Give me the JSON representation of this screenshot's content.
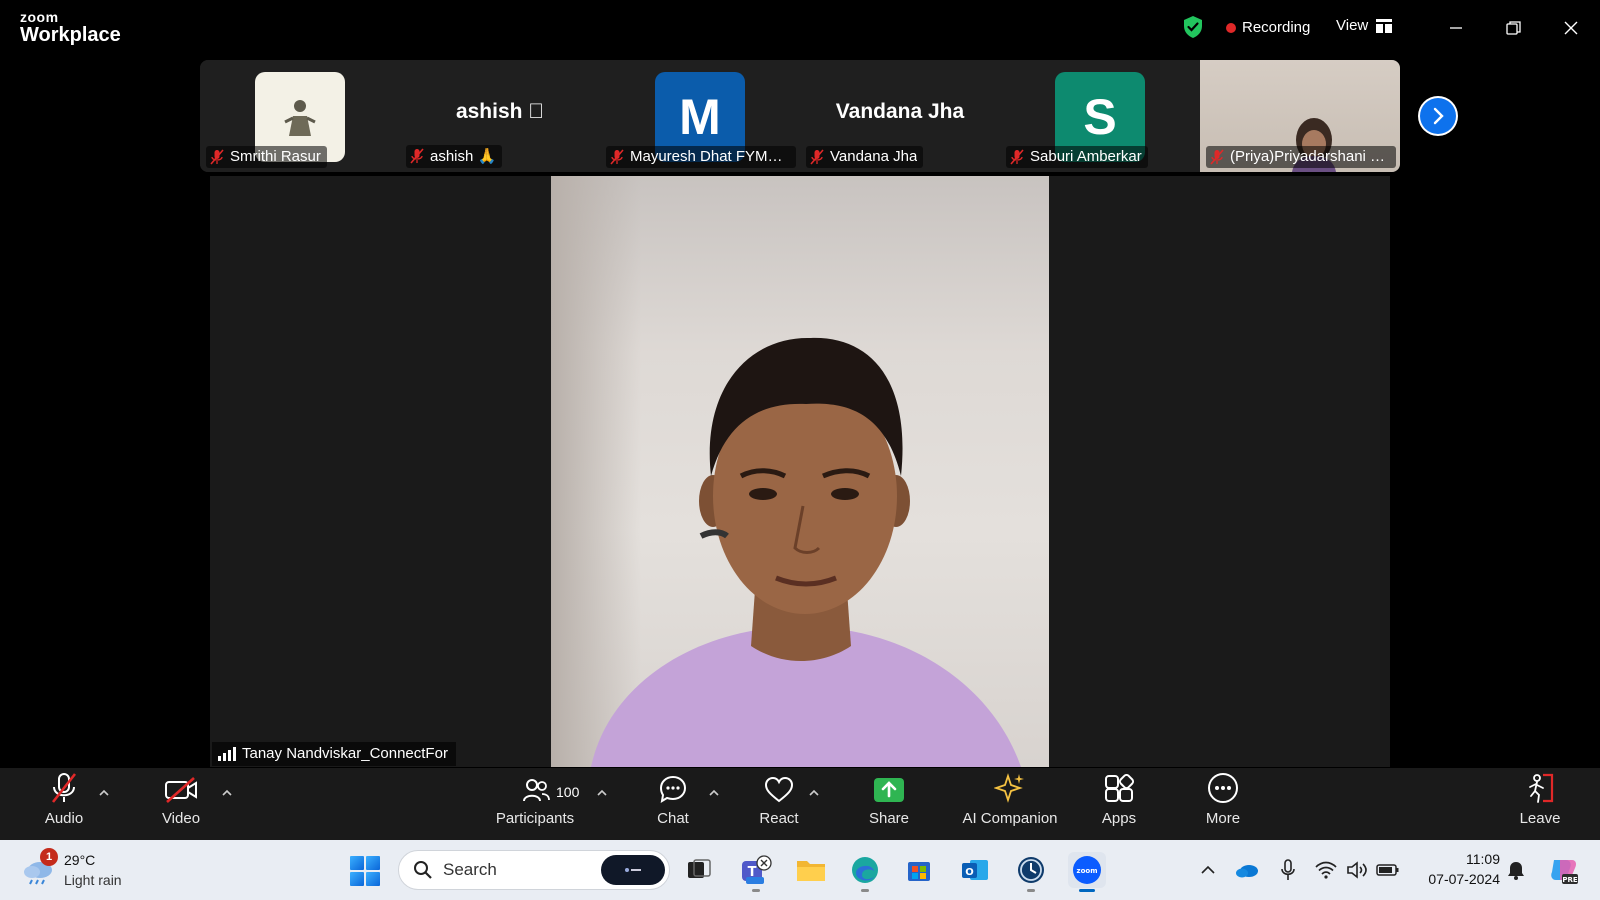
{
  "app": {
    "logo_top": "zoom",
    "logo_bottom": "Workplace",
    "recording_label": "Recording",
    "view_label": "View"
  },
  "gallery": {
    "tiles": [
      {
        "name": "Smrithi Rasur",
        "avatar_type": "image"
      },
      {
        "name": "ashish 🙏",
        "display_name": "ashish ⃞",
        "avatar_type": "text"
      },
      {
        "name": "Mayuresh Dhat FYMC...",
        "avatar_letter": "M",
        "avatar_color": "#0b5cab",
        "avatar_type": "letter"
      },
      {
        "name": "Vandana Jha",
        "display_name": "Vandana Jha",
        "avatar_type": "text"
      },
      {
        "name": "Saburi Amberkar",
        "avatar_letter": "S",
        "avatar_color": "#0d8a6f",
        "avatar_type": "letter"
      },
      {
        "name": "(Priya)Priyadarshani K...",
        "avatar_type": "video"
      }
    ]
  },
  "speaker": {
    "name": "Tanay Nandviskar_ConnectFor"
  },
  "toolbar": {
    "audio": "Audio",
    "video": "Video",
    "participants": "Participants",
    "participants_count": "100",
    "chat": "Chat",
    "react": "React",
    "share": "Share",
    "ai_companion": "AI Companion",
    "apps": "Apps",
    "more": "More",
    "leave": "Leave"
  },
  "taskbar": {
    "weather_badge": "1",
    "temperature": "29°C",
    "condition": "Light rain",
    "search_placeholder": "Search",
    "time": "11:09",
    "date": "07-07-2024"
  },
  "colors": {
    "accent": "#0e72ed",
    "recording": "#e02828",
    "share_green": "#2fb552",
    "leave_red": "#e02828"
  }
}
